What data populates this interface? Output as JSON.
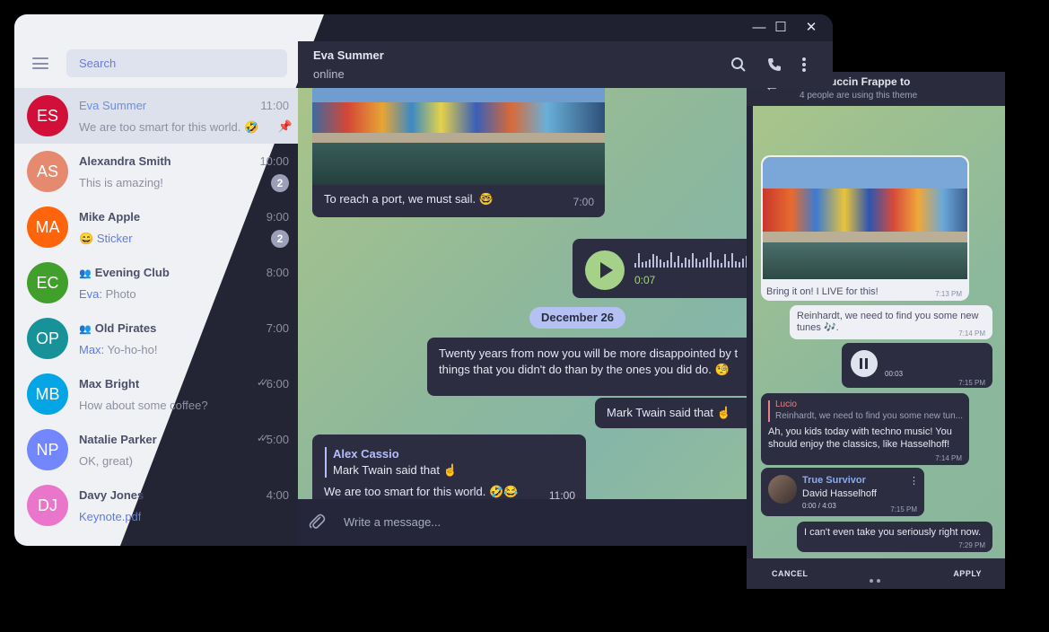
{
  "desktop": {
    "search_placeholder": "Search",
    "window_controls": {
      "minimize": "—",
      "maximize": "☐",
      "close": "✕"
    },
    "chats": [
      {
        "initials": "ES",
        "color": "#d20f39",
        "name": "Eva Summer",
        "time": "11:00",
        "preview": "We are too smart for this world. 🤣",
        "pinned": true,
        "active": true
      },
      {
        "initials": "AS",
        "color": "#e58a6e",
        "name": "Alexandra Smith",
        "time": "10:00",
        "preview": "This is amazing!",
        "badge": "2"
      },
      {
        "initials": "MA",
        "color": "#fe640b",
        "name": "Mike Apple",
        "time": "9:00",
        "preview_emoji": "😄",
        "preview_accent": "Sticker",
        "badge": "2"
      },
      {
        "initials": "EC",
        "color": "#40a02b",
        "name": "Evening Club",
        "time": "8:00",
        "preview_accent": "Eva: ",
        "preview": "Photo",
        "group": true
      },
      {
        "initials": "OP",
        "color": "#179299",
        "name": "Old Pirates",
        "time": "7:00",
        "preview_accent": "Max:",
        "preview": " Yo-ho-ho!",
        "group": true
      },
      {
        "initials": "MB",
        "color": "#04a5e5",
        "name": "Max Bright",
        "time": "6:00",
        "preview": "How about some coffee?",
        "read": true
      },
      {
        "initials": "NP",
        "color": "#7287fd",
        "name": "Natalie Parker",
        "time": "5:00",
        "preview": "OK, great)",
        "read": true
      },
      {
        "initials": "DJ",
        "color": "#ea76cb",
        "name": "Davy Jones",
        "time": "4:00",
        "preview_accent": "Keynote.pdf"
      }
    ],
    "header": {
      "name": "Eva Summer",
      "status": "online"
    },
    "messages": {
      "photo_caption": "To reach a port, we must sail. 🤓",
      "photo_time": "7:00",
      "voice_duration": "0:07",
      "date": "December 26",
      "quote_line1": "Twenty years from now you will be more disappointed by t",
      "quote_line2": "things that you didn't do than by the ones you did do. 🧐",
      "mark_twain": "Mark Twain said that ☝️",
      "reply_author": "Alex Cassio",
      "reply_text": "Mark Twain said that ☝️",
      "last_text": "We are too smart for this world. 🤣😂",
      "last_time": "11:00"
    },
    "input_placeholder": "Write a message..."
  },
  "mobile": {
    "title": "Catppuccin Frappe   to",
    "subtitle": "4 people are using this theme",
    "photo_caption": "Bring it on! I LIVE for this!",
    "photo_time": "7:13 PM",
    "msg1": "Reinhardt, we need to find you some new tunes 🎶.",
    "msg1_time": "7:14 PM",
    "voice_time": "00:03",
    "voice_msg_time": "7:15 PM",
    "reply_author": "Lucio",
    "reply_quote": "Reinhardt, we need to find you some new tun...",
    "reply_text": "Ah, you kids today with techno music! You should enjoy the classics, like Hasselhoff!",
    "reply_time": "7:14 PM",
    "music_title": "True Survivor",
    "music_artist": "David Hasselhoff",
    "music_progress": "0:00 / 4:03",
    "music_time": "7:15 PM",
    "last_text": "I can't even take you seriously right now.",
    "last_time": "7:29 PM",
    "cancel": "CANCEL",
    "apply": "APPLY"
  }
}
